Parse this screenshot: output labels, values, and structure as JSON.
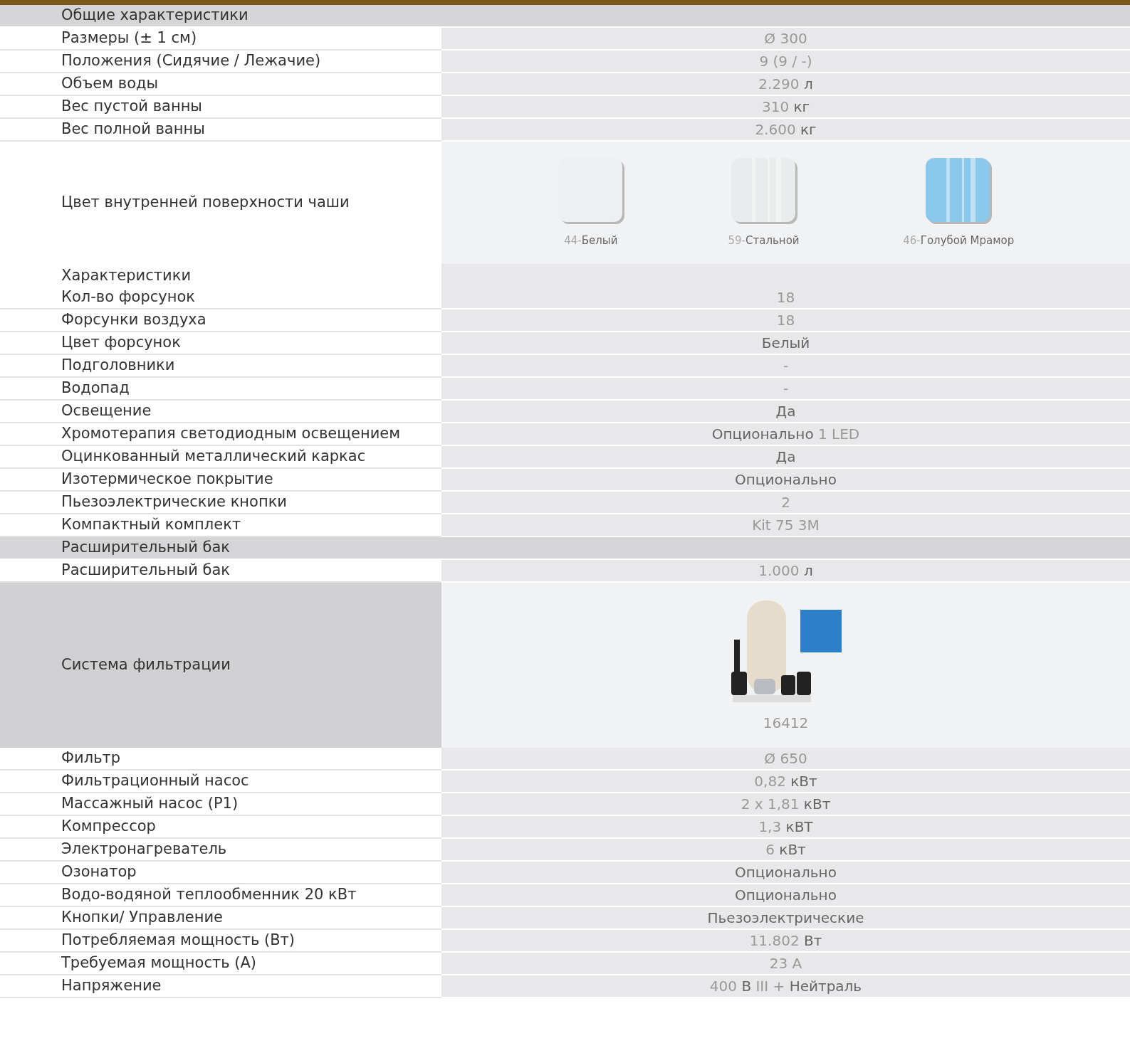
{
  "rows": [
    {
      "kind": "section",
      "label": "Общие характеристики"
    },
    {
      "kind": "row",
      "label": "Размеры (± 1 см)",
      "value": "Ø 300"
    },
    {
      "kind": "row",
      "label": "Положения (Сидячие / Лежачие)",
      "value": "9 (9 / -)"
    },
    {
      "kind": "row",
      "label": "Объем воды",
      "value": "2.290 **л**"
    },
    {
      "kind": "row",
      "label": "Вес пустой ванны",
      "value": "310 **кг**"
    },
    {
      "kind": "row",
      "label": "Вес полной ванны",
      "value": "2.600 **кг**"
    },
    {
      "kind": "swatches",
      "label": "Цвет внутренней поверхности чаши",
      "swatches": [
        {
          "code": "44-",
          "name": "Белый",
          "color": "#eeeff3"
        },
        {
          "code": "59-",
          "name": "Стальной",
          "color": "#e8ecec"
        },
        {
          "code": "46-",
          "name": "Голубой Мрамор",
          "color": "#8cc8ec"
        }
      ]
    },
    {
      "kind": "subheader",
      "label": "Характеристики"
    },
    {
      "kind": "row",
      "label": "Кол-во форсунок",
      "value": "18"
    },
    {
      "kind": "row",
      "label": "Форсунки воздуха",
      "value": "18"
    },
    {
      "kind": "row",
      "label": "Цвет форсунок",
      "value": "**Белый**"
    },
    {
      "kind": "row",
      "label": "Подголовники",
      "value": "-"
    },
    {
      "kind": "row",
      "label": "Водопад",
      "value": "-"
    },
    {
      "kind": "row",
      "label": "Освещение",
      "value": "**Да**"
    },
    {
      "kind": "row",
      "label": "Хромотерапия светодиодным освещением",
      "value": "**Опционально** 1 LED"
    },
    {
      "kind": "row",
      "label": "Оцинкованный металлический каркас",
      "value": "**Да**"
    },
    {
      "kind": "row",
      "label": "Изотермическое покрытие",
      "value": "**Опционально**"
    },
    {
      "kind": "row",
      "label": "Пьезоэлектрические кнопки",
      "value": "2"
    },
    {
      "kind": "row",
      "label": "Компактный комплект",
      "value": "Kit 75 3M"
    },
    {
      "kind": "section",
      "label": "Расширительный бак"
    },
    {
      "kind": "row",
      "label": "Расширительный бак",
      "value": "1.000 **л**"
    },
    {
      "kind": "image",
      "label": "Система фильтрации",
      "value": "16412"
    },
    {
      "kind": "row",
      "label": "Фильтр",
      "value": "Ø 650"
    },
    {
      "kind": "row",
      "label": "Фильтрационный насос",
      "value": "0,82 **кВт**"
    },
    {
      "kind": "row",
      "label": "Массажный насос (P1)",
      "value": "2 x 1,81 **кВт**"
    },
    {
      "kind": "row",
      "label": "Компрессор",
      "value": "1,3 **кВТ**"
    },
    {
      "kind": "row",
      "label": "Электронагреватель",
      "value": "6 **кВт**"
    },
    {
      "kind": "row",
      "label": "Озонатор",
      "value": "**Опционально**"
    },
    {
      "kind": "row",
      "label": "Водо-водяной теплообменник 20 кВт",
      "value": "**Опционально**"
    },
    {
      "kind": "row",
      "label": "Кнопки/ Управление",
      "value": "**Пьезоэлектрические**"
    },
    {
      "kind": "row",
      "label": "Потребляемая мощность (Вт)",
      "value": "11.802 **Вт**"
    },
    {
      "kind": "row",
      "label": "Требуемая мощность (A)",
      "value": "23 A"
    },
    {
      "kind": "row",
      "label": "Напряжение",
      "value": "400 **В** III + **Нейтраль**"
    }
  ]
}
